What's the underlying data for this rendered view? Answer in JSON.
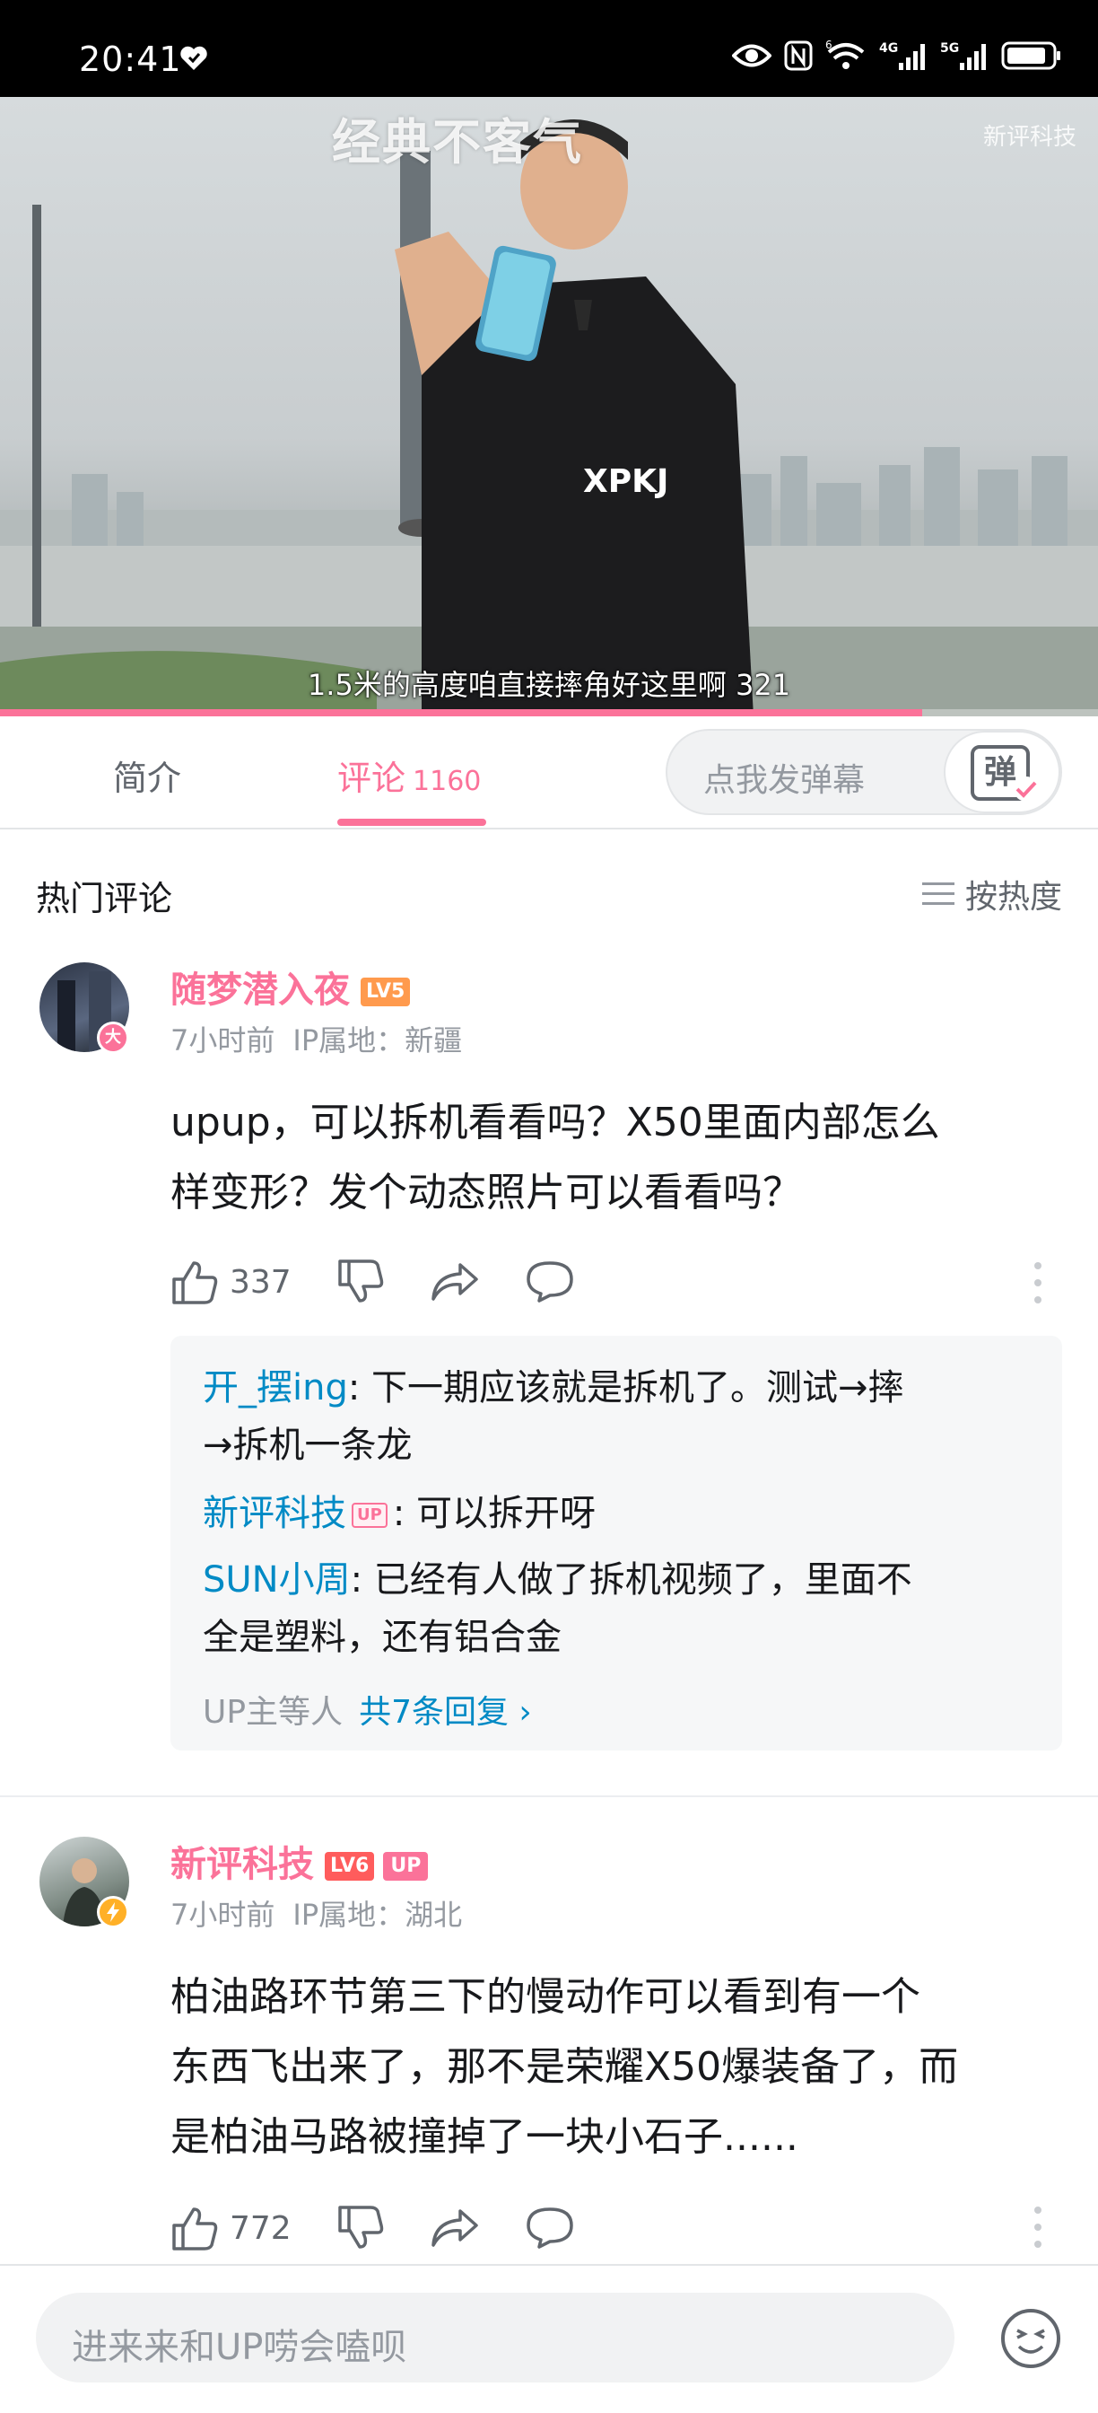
{
  "status_bar": {
    "time": "20:41",
    "icons": [
      "heart-icon",
      "eye-icon",
      "nfc-icon",
      "wifi-6-icon",
      "signal-4g-icon",
      "signal-5g-icon",
      "battery-icon"
    ],
    "network_labels": [
      "6",
      "4G",
      "5G"
    ]
  },
  "video": {
    "watermark": "经典不客气",
    "channel_watermark": "新评科技",
    "subtitle": "1.5米的高度咱直接摔角好这里啊 321",
    "progress": 0.84,
    "shirt_text": "XPKJ"
  },
  "tabs": {
    "intro": "简介",
    "comments": "评论",
    "comments_count": "1160",
    "danmaku_placeholder": "点我发弹幕",
    "danmaku_button": "弹"
  },
  "comments_header": {
    "title": "热门评论",
    "sort": "按热度"
  },
  "comments": [
    {
      "username": "随梦潜入夜",
      "level": "LV5",
      "badge": "大",
      "time": "7小时前",
      "ip": "IP属地：新疆",
      "text_lines": [
        "upup，可以拆机看看吗？X50里面内部怎么",
        "样变形？发个动态照片可以看看吗？"
      ],
      "likes": "337",
      "replies": [
        {
          "user": "开_摆ing",
          "text": ": 下一期应该就是拆机了。测试→摔",
          "text2": "→拆机一条龙"
        },
        {
          "user": "新评科技",
          "up": "UP",
          "text": ": 可以拆开呀"
        },
        {
          "user": "SUN小周",
          "text": ": 已经有人做了拆机视频了，里面不",
          "text2": "全是塑料，还有铝合金"
        }
      ],
      "reply_summary": "UP主等人",
      "reply_link": "共7条回复 ›"
    },
    {
      "username": "新评科技",
      "level": "LV6",
      "up_tag": "UP",
      "time": "7小时前",
      "ip": "IP属地：湖北",
      "text_lines": [
        "柏油路环节第三下的慢动作可以看到有一个",
        "东西飞出来了，那不是荣耀X50爆装备了，而",
        "是柏油马路被撞掉了一块小石子......"
      ],
      "likes": "772"
    }
  ],
  "bottom_bar": {
    "placeholder": "进来来和UP唠会嗑呗"
  },
  "colors": {
    "accent": "#fb7299",
    "link": "#008ac5",
    "lv5": "#ff9a4d",
    "lv6": "#ff5c5c"
  }
}
